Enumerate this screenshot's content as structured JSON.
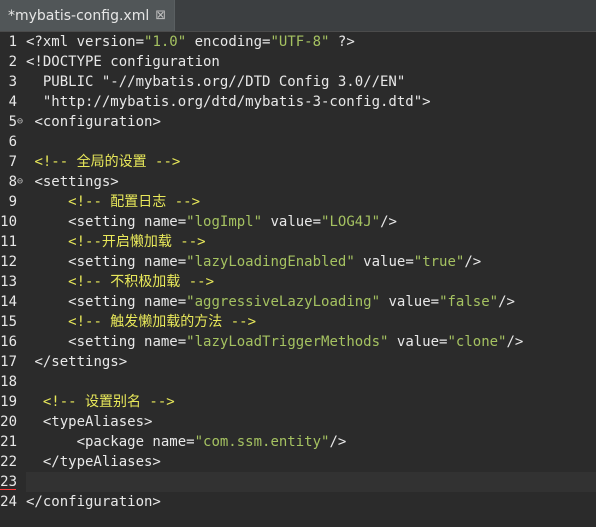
{
  "tab": {
    "title": "*mybatis-config.xml",
    "close_glyph": "⊠"
  },
  "lines": [
    {
      "n": "1",
      "indent": "",
      "segments": [
        [
          "p",
          "<?xml version="
        ],
        [
          "v",
          "\"1.0\""
        ],
        [
          "p",
          " encoding="
        ],
        [
          "v",
          "\"UTF-8\""
        ],
        [
          "p",
          " ?>"
        ]
      ]
    },
    {
      "n": "2",
      "indent": "",
      "segments": [
        [
          "p",
          "<!DOCTYPE configuration"
        ]
      ]
    },
    {
      "n": "3",
      "indent": "  ",
      "segments": [
        [
          "p",
          "PUBLIC \"-//mybatis.org//DTD Config 3.0//EN\""
        ]
      ]
    },
    {
      "n": "4",
      "indent": "  ",
      "segments": [
        [
          "p",
          "\"http://mybatis.org/dtd/mybatis-3-config.dtd\">"
        ]
      ]
    },
    {
      "n": "5",
      "fold": true,
      "indent": " ",
      "segments": [
        [
          "p",
          "<configuration>"
        ]
      ]
    },
    {
      "n": "6",
      "indent": "",
      "segments": []
    },
    {
      "n": "7",
      "indent": " ",
      "segments": [
        [
          "c",
          "<!-- 全局的设置 -->"
        ]
      ]
    },
    {
      "n": "8",
      "fold": true,
      "indent": " ",
      "segments": [
        [
          "p",
          "<settings>"
        ]
      ]
    },
    {
      "n": "9",
      "indent": "     ",
      "segments": [
        [
          "c",
          "<!-- 配置日志 -->"
        ]
      ]
    },
    {
      "n": "10",
      "indent": "     ",
      "segments": [
        [
          "p",
          "<setting name="
        ],
        [
          "v",
          "\"logImpl\""
        ],
        [
          "p",
          " value="
        ],
        [
          "v",
          "\"LOG4J\""
        ],
        [
          "p",
          "/>"
        ]
      ]
    },
    {
      "n": "11",
      "indent": "     ",
      "segments": [
        [
          "c",
          "<!--开启懒加载 -->"
        ]
      ]
    },
    {
      "n": "12",
      "indent": "     ",
      "segments": [
        [
          "p",
          "<setting name="
        ],
        [
          "v",
          "\"lazyLoadingEnabled\""
        ],
        [
          "p",
          " value="
        ],
        [
          "v",
          "\"true\""
        ],
        [
          "p",
          "/>"
        ]
      ]
    },
    {
      "n": "13",
      "indent": "     ",
      "segments": [
        [
          "c",
          "<!-- 不积极加载 -->"
        ]
      ]
    },
    {
      "n": "14",
      "indent": "     ",
      "segments": [
        [
          "p",
          "<setting name="
        ],
        [
          "v",
          "\"aggressiveLazyLoading\""
        ],
        [
          "p",
          " value="
        ],
        [
          "v",
          "\"false\""
        ],
        [
          "p",
          "/>"
        ]
      ]
    },
    {
      "n": "15",
      "indent": "     ",
      "segments": [
        [
          "c",
          "<!-- 触发懒加载的方法 -->"
        ]
      ]
    },
    {
      "n": "16",
      "indent": "     ",
      "segments": [
        [
          "p",
          "<setting name="
        ],
        [
          "v",
          "\"lazyLoadTriggerMethods\""
        ],
        [
          "p",
          " value="
        ],
        [
          "v",
          "\"clone\""
        ],
        [
          "p",
          "/>"
        ]
      ]
    },
    {
      "n": "17",
      "indent": " ",
      "segments": [
        [
          "p",
          "</settings>"
        ]
      ]
    },
    {
      "n": "18",
      "indent": "",
      "segments": []
    },
    {
      "n": "19",
      "indent": "  ",
      "segments": [
        [
          "c",
          "<!-- 设置别名 -->"
        ]
      ]
    },
    {
      "n": "20",
      "indent": "  ",
      "segments": [
        [
          "p",
          "<typeAliases>"
        ]
      ]
    },
    {
      "n": "21",
      "indent": "      ",
      "segments": [
        [
          "p",
          "<package name="
        ],
        [
          "v",
          "\"com.ssm.entity\""
        ],
        [
          "p",
          "/>"
        ]
      ]
    },
    {
      "n": "22",
      "indent": "  ",
      "segments": [
        [
          "p",
          "</typeAliases>"
        ]
      ]
    },
    {
      "n": "23",
      "indent": "",
      "segments": [],
      "current": true
    },
    {
      "n": "24",
      "indent": "",
      "segments": [
        [
          "p",
          "</configuration>"
        ]
      ]
    }
  ]
}
